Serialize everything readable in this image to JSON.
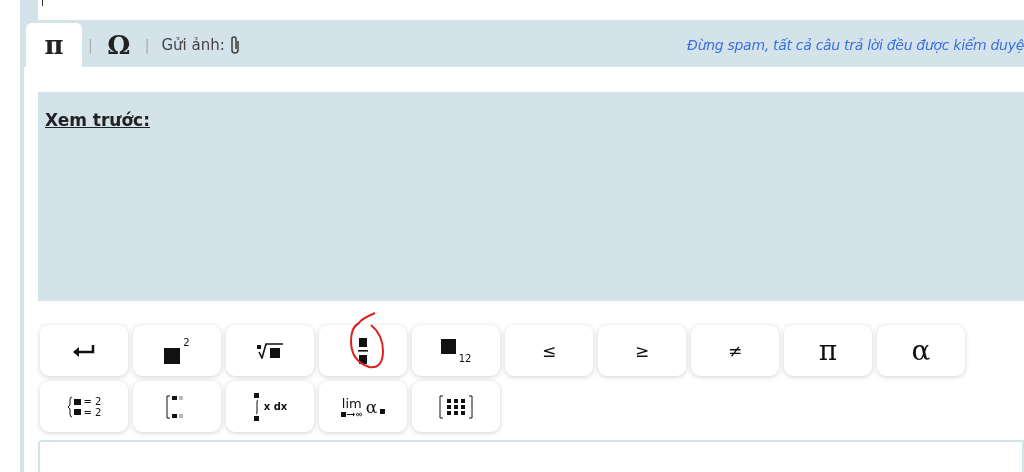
{
  "answer_field": {
    "cursor": true
  },
  "tabs": [
    {
      "label": "π",
      "selected": true
    },
    {
      "label": "Ω",
      "selected": false
    }
  ],
  "tab_separators": [
    "|",
    "|"
  ],
  "upload": {
    "label": "Gửi ảnh:"
  },
  "notice": "Đừng spam, tất cả câu trả lời đều được kiểm duyệ",
  "preview": {
    "label": "Xem trước:"
  },
  "keypad": [
    [
      {
        "kind": "enter"
      },
      {
        "kind": "power",
        "text": "2"
      },
      {
        "kind": "root"
      },
      {
        "kind": "fraction",
        "circled": true
      },
      {
        "kind": "subscript",
        "text": "12"
      },
      {
        "kind": "symbol",
        "text": "≤"
      },
      {
        "kind": "symbol",
        "text": "≥"
      },
      {
        "kind": "symbol",
        "text": "≠"
      },
      {
        "kind": "letter",
        "text": "π"
      },
      {
        "kind": "letter",
        "text": "α"
      }
    ],
    [
      {
        "kind": "system",
        "texts": [
          "= 2",
          "= 2"
        ]
      },
      {
        "kind": "matrix-column"
      },
      {
        "kind": "integral",
        "text": "x dx"
      },
      {
        "kind": "limit",
        "text": "lim",
        "extra": "α"
      },
      {
        "kind": "matrix"
      }
    ]
  ]
}
